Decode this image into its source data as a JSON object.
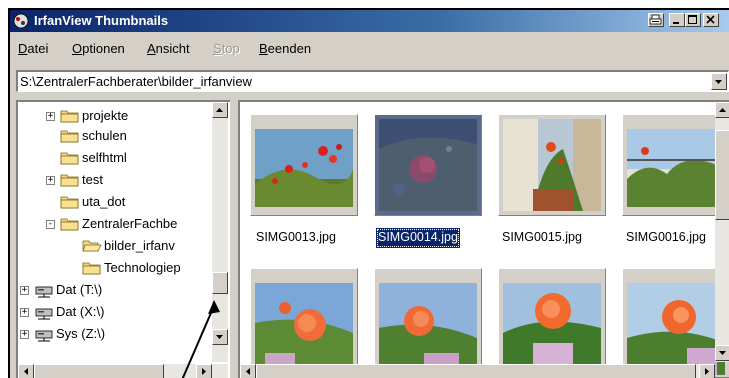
{
  "window": {
    "title": "IrfanView Thumbnails",
    "title_buttons": [
      "print-icon",
      "minimize-icon",
      "maximize-icon",
      "close-icon"
    ]
  },
  "menu": {
    "items": [
      {
        "label": "Datei",
        "enabled": true
      },
      {
        "label": "Optionen",
        "enabled": true
      },
      {
        "label": "Ansicht",
        "enabled": true
      },
      {
        "label": "Stop",
        "enabled": false
      },
      {
        "label": "Beenden",
        "enabled": true
      }
    ]
  },
  "address": {
    "path": "S:\\ZentralerFachberater\\bilder_irfanview"
  },
  "tree": {
    "items": [
      {
        "label": "projekte",
        "expander": "+",
        "icon": "folder-icon"
      },
      {
        "label": "schulen",
        "expander": "",
        "icon": "folder-icon"
      },
      {
        "label": "selfhtml",
        "expander": "",
        "icon": "folder-icon"
      },
      {
        "label": "test",
        "expander": "+",
        "icon": "folder-icon"
      },
      {
        "label": "uta_dot",
        "expander": "",
        "icon": "folder-icon"
      },
      {
        "label": "ZentralerFachbe",
        "expander": "-",
        "icon": "folder-icon"
      },
      {
        "label": "bilder_irfanv",
        "expander": "",
        "icon": "open-folder-icon"
      },
      {
        "label": "Technologiep",
        "expander": "",
        "icon": "folder-icon"
      },
      {
        "label": "Dat (T:\\)",
        "expander": "+",
        "icon": "network-drive-icon"
      },
      {
        "label": "Dat (X:\\)",
        "expander": "+",
        "icon": "network-drive-icon"
      },
      {
        "label": "Sys (Z:\\)",
        "expander": "+",
        "icon": "network-drive-icon"
      }
    ]
  },
  "thumbnails": {
    "row1": [
      {
        "filename": "SIMG0013.jpg",
        "selected": false
      },
      {
        "filename": "SIMG0014.jpg",
        "selected": true
      },
      {
        "filename": "SIMG0015.jpg",
        "selected": false
      },
      {
        "filename": "SIMG0016.jpg",
        "selected": false
      }
    ],
    "row2_count": 4
  },
  "colors": {
    "selection": "#0a246a",
    "face": "#d4d0c8"
  }
}
